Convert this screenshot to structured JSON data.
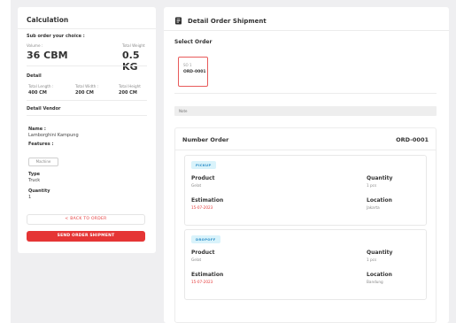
{
  "calculation": {
    "title": "Calculation",
    "subtitle": "Sub order your choice :",
    "volume_label": "Volume :",
    "volume_value": "36 CBM",
    "weight_label": "Total Weight",
    "weight_value": "0.5 KG",
    "detail_label": "Detail",
    "dims": [
      {
        "label": "Total Length :",
        "value": "400 CM"
      },
      {
        "label": "Total Width :",
        "value": "200 CM"
      },
      {
        "label": "Total Height",
        "value": "200 CM"
      }
    ],
    "vendor_label": "Detail Vendor",
    "name_label": "Name :",
    "name_value": "Lamborghini Kampung",
    "features_label": "Features :",
    "feature_tag": "Machine",
    "type_label": "Type",
    "type_value": "Truck",
    "quantity_label": "Quantity",
    "quantity_value": "1",
    "back_button": "< BACK TO ORDER",
    "send_button": "SEND ORDER SHIPMENT"
  },
  "detail": {
    "title": "Detail Order Shipment",
    "select_label": "Select Order",
    "order_no": "SO 1",
    "order_id": "ORD-0001",
    "note_placeholder": "Note",
    "number_order_label": "Number Order",
    "number_order_value": "ORD-0001",
    "stops": [
      {
        "badge": "PICKUP",
        "product_label": "Product",
        "product_value": "Gelat",
        "quantity_label": "Quantity",
        "quantity_value": "1 pcs",
        "estimation_label": "Estimation",
        "estimation_value": "15-07-2023",
        "location_label": "Location",
        "location_value": "Jakarta"
      },
      {
        "badge": "DROPOFF",
        "product_label": "Product",
        "product_value": "Gelat",
        "quantity_label": "Quantity",
        "quantity_value": "1 pcs",
        "estimation_label": "Estimation",
        "estimation_value": "15-07-2023",
        "location_label": "Location",
        "location_value": "Bandung"
      }
    ]
  },
  "colors": {
    "accent": "#e53535",
    "badge_bg": "#d9f3fb",
    "badge_text": "#2f8fc8"
  },
  "icons": {
    "detail_header": "document-icon"
  }
}
